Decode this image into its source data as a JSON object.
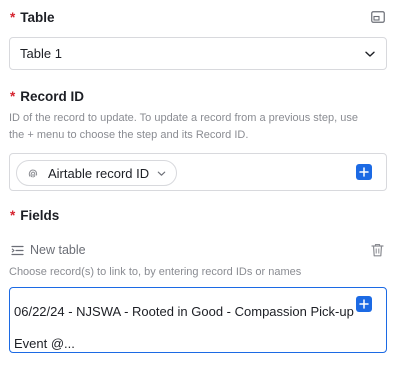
{
  "table": {
    "required_marker": "*",
    "label": "Table",
    "selected": "Table 1"
  },
  "record_id": {
    "required_marker": "*",
    "label": "Record ID",
    "help_line1": "ID of the record to update. To update a record from a previous step, use",
    "help_line2": "the + menu to choose the step and its Record ID.",
    "pill_label": "Airtable record ID"
  },
  "fields": {
    "required_marker": "*",
    "label": "Fields",
    "subtable_label": "New table",
    "help": "Choose record(s) to link to, by entering record IDs or names",
    "value": "06/22/24 - NJSWA - Rooted in Good - Compassion Pick-up Event @..."
  },
  "colors": {
    "required": "#d5232f",
    "accent": "#1c6ae4",
    "help_text": "#8a8c92"
  },
  "icons": {
    "expand": "expand-panel-icon",
    "chevron": "chevron-down-icon",
    "fingerprint": "fingerprint-icon",
    "plus": "plus-icon",
    "list": "list-indent-icon",
    "trash": "trash-icon"
  }
}
